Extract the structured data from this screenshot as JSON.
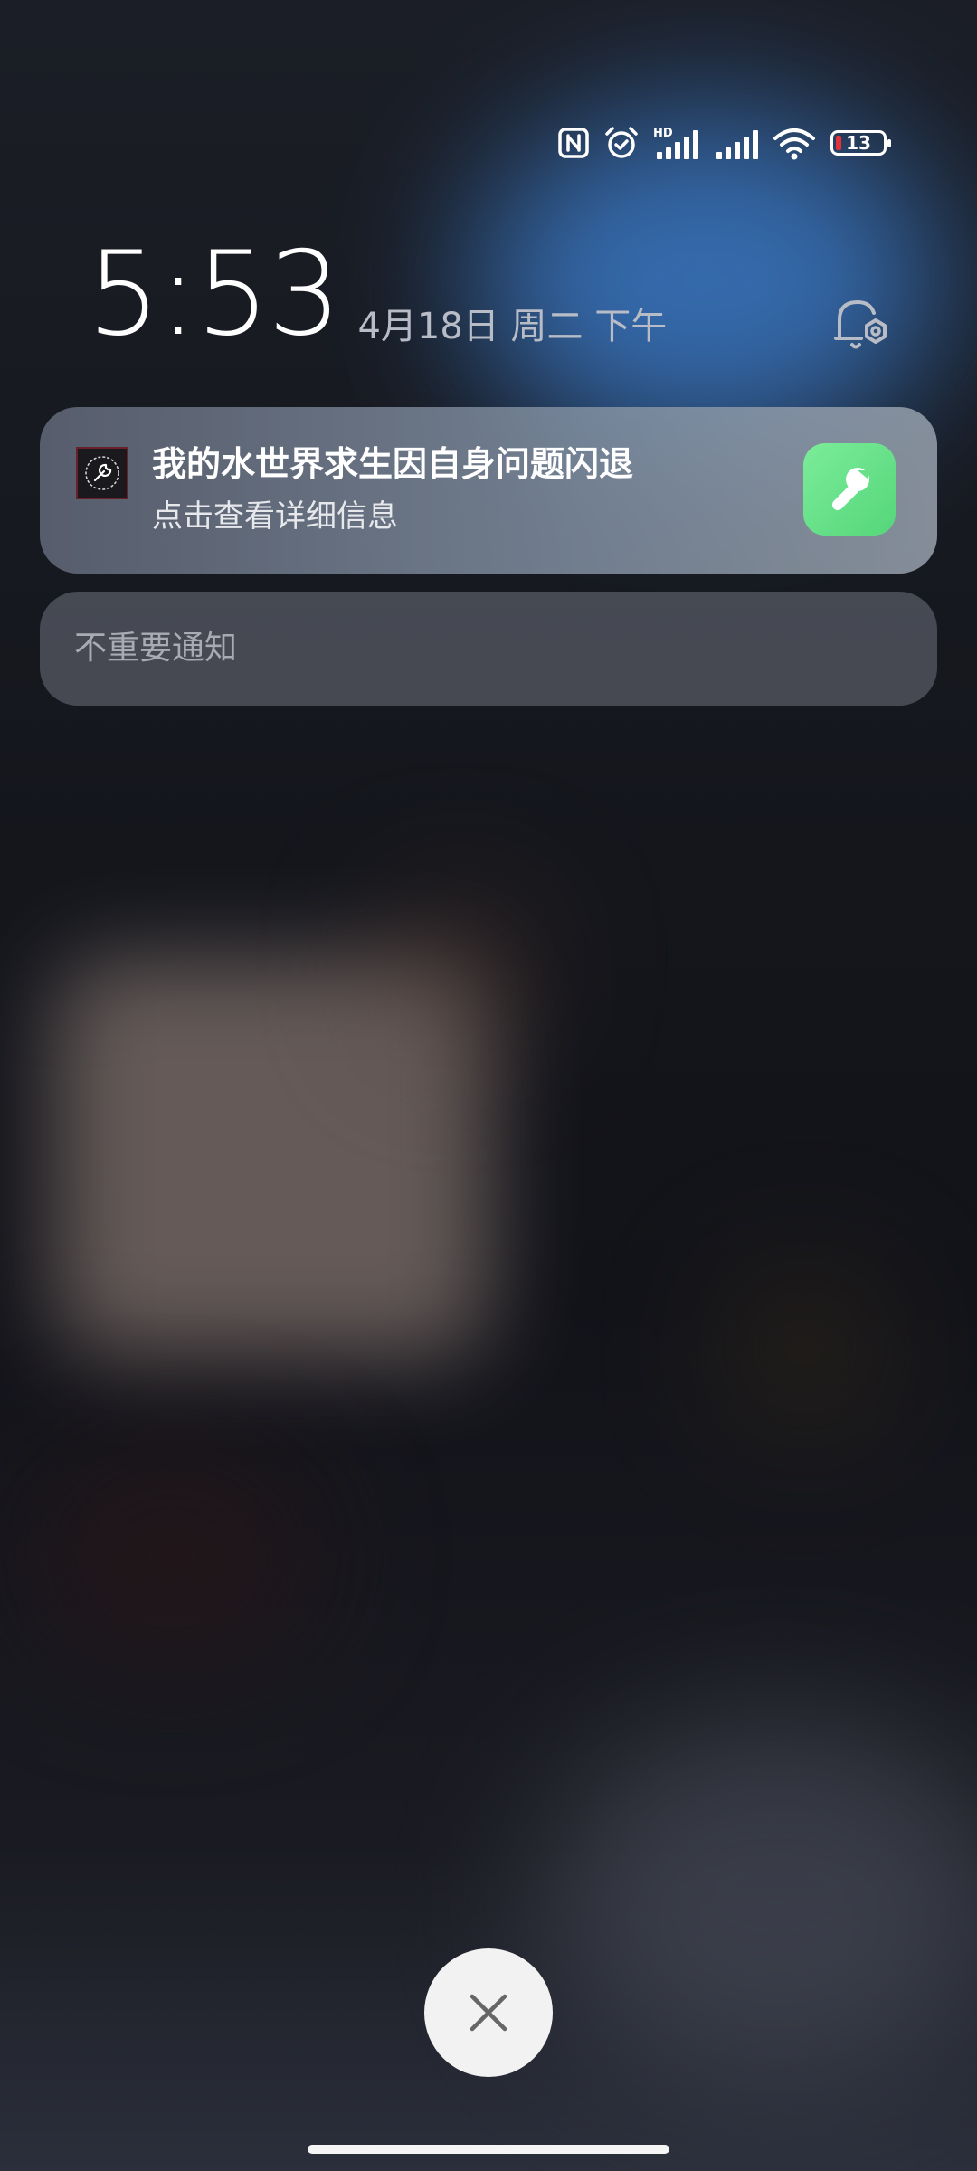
{
  "status_bar": {
    "icons": [
      "nfc-icon",
      "alarm-icon",
      "hd-signal-icon",
      "signal-icon",
      "wifi-icon",
      "battery-icon"
    ],
    "hd_label": "HD",
    "battery_level": "13",
    "battery_color": "#e3333a"
  },
  "lockscreen": {
    "time": "5:53",
    "date": "4月18日 周二 下午",
    "settings_icon": "notification-settings-icon"
  },
  "notification": {
    "title": "我的水世界求生因自身问题闪退",
    "body": "点击查看详细信息",
    "small_icon": "wrench-icon",
    "large_icon": "wrench-icon",
    "large_icon_color": "#5ed882"
  },
  "secondary_group": {
    "label": "不重要通知"
  },
  "dismiss": {
    "icon": "close-icon"
  }
}
